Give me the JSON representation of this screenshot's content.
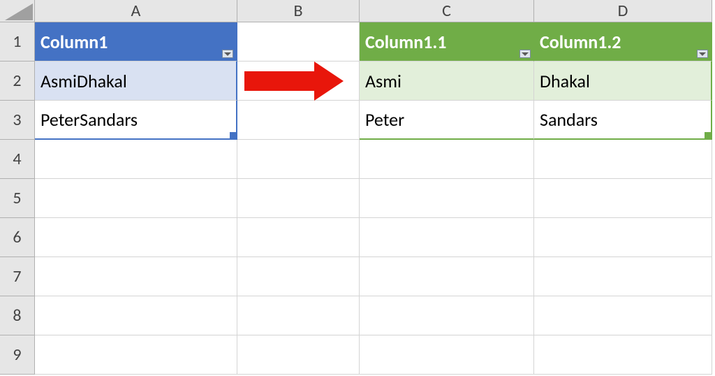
{
  "columns": [
    "A",
    "B",
    "C",
    "D"
  ],
  "rows": [
    "1",
    "2",
    "3",
    "4",
    "5",
    "6",
    "7",
    "8",
    "9"
  ],
  "table_blue": {
    "header": "Column1",
    "rows": [
      "AsmiDhakal",
      "PeterSandars"
    ]
  },
  "table_green": {
    "headers": [
      "Column1.1",
      "Column1.2"
    ],
    "rows": [
      [
        "Asmi",
        "Dhakal"
      ],
      [
        "Peter",
        "Sandars"
      ]
    ]
  }
}
